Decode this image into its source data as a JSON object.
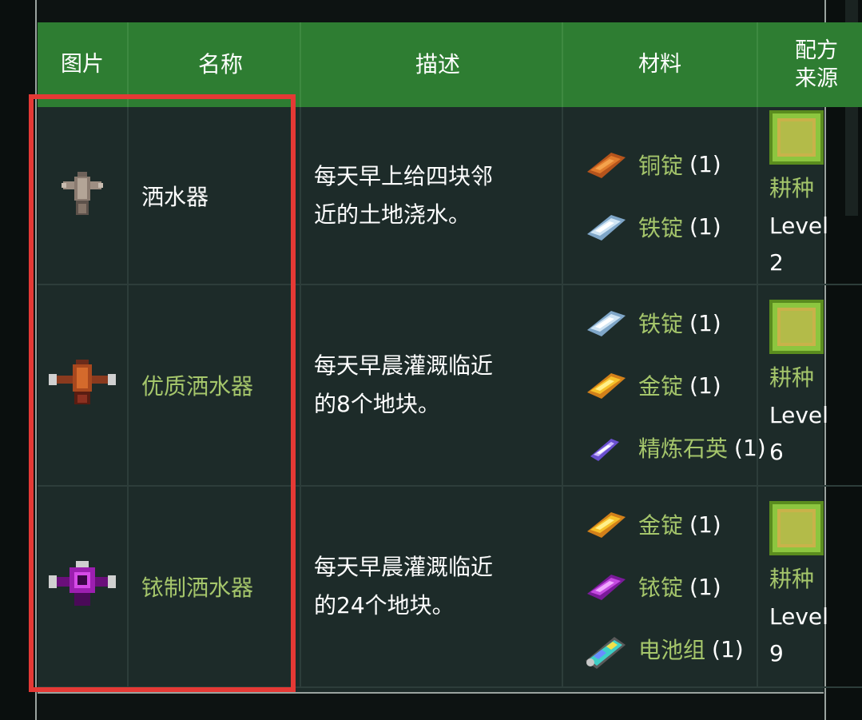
{
  "header": {
    "col_image": "图片",
    "col_name": "名称",
    "col_desc": "描述",
    "col_materials": "材料",
    "col_source_line1": "配方",
    "col_source_line2": "来源"
  },
  "rows": [
    {
      "name": "洒水器",
      "desc_line1": "每天早上给四块邻",
      "desc_line2": "近的土地浇水。",
      "materials": [
        {
          "name": "铜锭",
          "qty": "(1)",
          "icon": "copper-bar-icon"
        },
        {
          "name": "铁锭",
          "qty": "(1)",
          "icon": "iron-bar-icon"
        }
      ],
      "source_skill": "耕种",
      "source_level_label": "Level",
      "source_level": "2"
    },
    {
      "name": "优质洒水器",
      "desc_line1": "每天早晨灌溉临近",
      "desc_line2": "的8个地块。",
      "materials": [
        {
          "name": "铁锭",
          "qty": "(1)",
          "icon": "iron-bar-icon"
        },
        {
          "name": "金锭",
          "qty": "(1)",
          "icon": "gold-bar-icon"
        },
        {
          "name": "精炼石英",
          "qty": "(1)",
          "icon": "refined-quartz-icon"
        }
      ],
      "source_skill": "耕种",
      "source_level_label": "Level",
      "source_level": "6"
    },
    {
      "name": "铱制洒水器",
      "desc_line1": "每天早晨灌溉临近",
      "desc_line2": "的24个地块。",
      "materials": [
        {
          "name": "金锭",
          "qty": "(1)",
          "icon": "gold-bar-icon"
        },
        {
          "name": "铱锭",
          "qty": "(1)",
          "icon": "iridium-bar-icon"
        },
        {
          "name": "电池组",
          "qty": "(1)",
          "icon": "battery-pack-icon"
        }
      ],
      "source_skill": "耕种",
      "source_level_label": "Level",
      "source_level": "9"
    }
  ],
  "colors": {
    "header_bg": "#2e7d32",
    "row_bg": "#1d2b29",
    "green_text": "#a5c66b",
    "highlight": "#e53935"
  }
}
